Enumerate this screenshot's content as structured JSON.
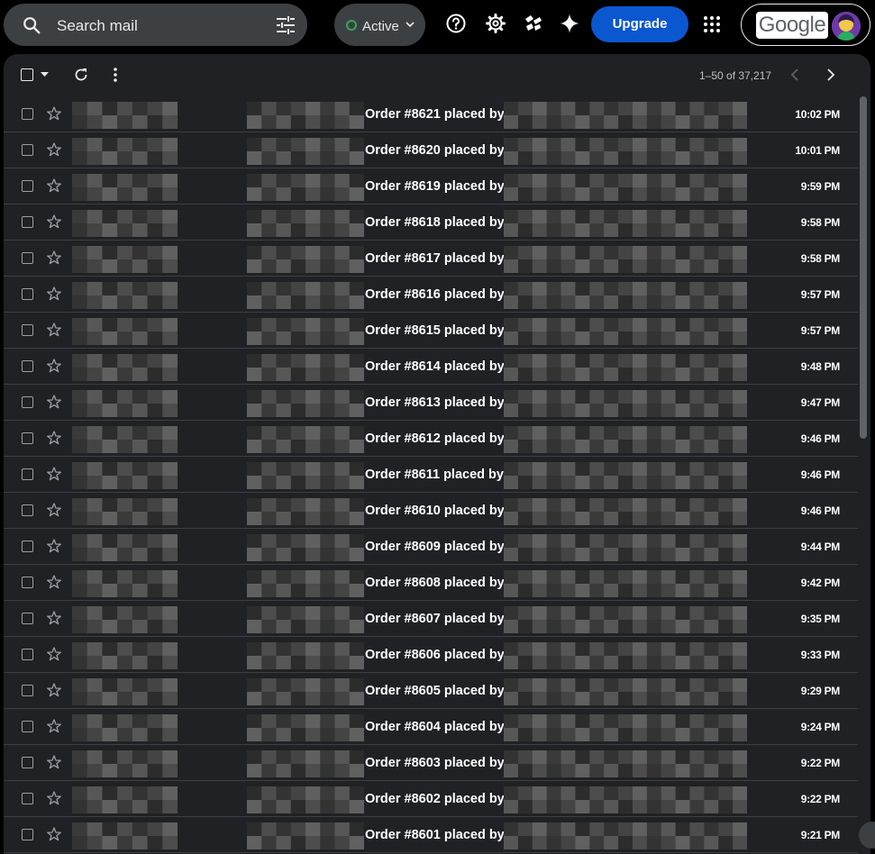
{
  "search": {
    "placeholder": "Search mail"
  },
  "status": {
    "label": "Active",
    "color": "#34a853"
  },
  "header": {
    "upgrade_label": "Upgrade",
    "account_logo": "Google"
  },
  "toolbar": {
    "range": "1–50 of 37,217"
  },
  "emails": [
    {
      "subject": "Order #8621 placed by",
      "time": "10:02 PM"
    },
    {
      "subject": "Order #8620 placed by",
      "time": "10:01 PM"
    },
    {
      "subject": "Order #8619 placed by",
      "time": "9:59 PM"
    },
    {
      "subject": "Order #8618 placed by",
      "time": "9:58 PM"
    },
    {
      "subject": "Order #8617 placed by",
      "time": "9:58 PM"
    },
    {
      "subject": "Order #8616 placed by",
      "time": "9:57 PM"
    },
    {
      "subject": "Order #8615 placed by",
      "time": "9:57 PM"
    },
    {
      "subject": "Order #8614 placed by",
      "time": "9:48 PM"
    },
    {
      "subject": "Order #8613 placed by",
      "time": "9:47 PM"
    },
    {
      "subject": "Order #8612 placed by",
      "time": "9:46 PM"
    },
    {
      "subject": "Order #8611 placed by",
      "time": "9:46 PM"
    },
    {
      "subject": "Order #8610 placed by",
      "time": "9:46 PM"
    },
    {
      "subject": "Order #8609 placed by",
      "time": "9:44 PM"
    },
    {
      "subject": "Order #8608 placed by",
      "time": "9:42 PM"
    },
    {
      "subject": "Order #8607 placed by",
      "time": "9:35 PM"
    },
    {
      "subject": "Order #8606 placed by",
      "time": "9:33 PM"
    },
    {
      "subject": "Order #8605 placed by",
      "time": "9:29 PM"
    },
    {
      "subject": "Order #8604 placed by",
      "time": "9:24 PM"
    },
    {
      "subject": "Order #8603 placed by",
      "time": "9:22 PM"
    },
    {
      "subject": "Order #8602 placed by",
      "time": "9:22 PM"
    },
    {
      "subject": "Order #8601 placed by",
      "time": "9:21 PM"
    }
  ]
}
